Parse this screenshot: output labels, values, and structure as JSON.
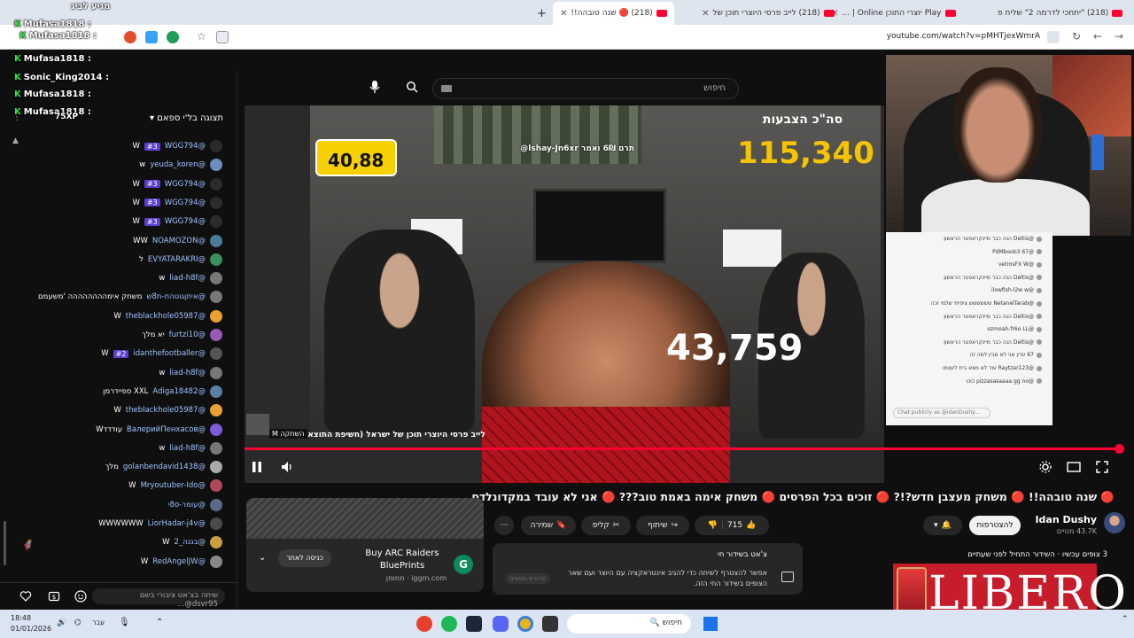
{
  "browser": {
    "tabs": [
      {
        "label": "(218) \"יתחכי לדרמה 2\" שליח פ"
      },
      {
        "label": "Play יוצרי התוכן Online | ..."
      },
      {
        "label": "(218) לייב פרסי היוצרי תוכן של"
      },
      {
        "label": "(218) 🔴 שנה טובהה!!"
      }
    ],
    "new_tab": "+",
    "url": "youtube.com/watch?v=pMHTjexWmrA"
  },
  "overlay": {
    "names": [
      "מגיע לביג",
      "Mufasa1818 :",
      "Mufasa1818 :",
      "Mufasa1818 :",
      "Sonic_King2014 :",
      "Mufasa1818 :",
      "Mufasa1818 :"
    ],
    "xp": "75XP"
  },
  "header": {
    "search_placeholder": "חיפוש"
  },
  "chat": {
    "selector": "תצוגה בל'י ספאם",
    "messages": [
      {
        "author": "@WGG794",
        "badge": "#3",
        "text": "W"
      },
      {
        "author": "@yeuda_koren",
        "badge": "",
        "text": "w"
      },
      {
        "author": "@WGG794",
        "badge": "#3",
        "text": "W"
      },
      {
        "author": "@WGG794",
        "badge": "#3",
        "text": "W"
      },
      {
        "author": "@WGG794",
        "badge": "#3",
        "text": "W"
      },
      {
        "author": "@NOAMOZON",
        "badge": "",
        "text": "WW"
      },
      {
        "author": "@EVYATARAKRI",
        "badge": "",
        "text": "ל"
      },
      {
        "author": "@liad-h8f",
        "badge": "",
        "text": "w"
      },
      {
        "author": "@איתןגוטהח-ת8ש",
        "badge": "",
        "text": "משחק אימהההההההה 'משעמם"
      },
      {
        "author": "@theblackhole05987",
        "badge": "",
        "text": "W"
      },
      {
        "author": "@furtzi10",
        "badge": "",
        "text": "יא מלך"
      },
      {
        "author": "@idanthefootballer",
        "badge": "#2",
        "text": "W"
      },
      {
        "author": "@liad-h8f",
        "badge": "",
        "text": "w"
      },
      {
        "author": "@Adiga18482",
        "badge": "",
        "text": "XXL ספיידרמן"
      },
      {
        "author": "@theblackhole05987",
        "badge": "",
        "text": "W"
      },
      {
        "author": "@ВалерийПенхасов",
        "badge": "",
        "text": "עודדדW"
      },
      {
        "author": "@liad-h8f",
        "badge": "",
        "text": "w"
      },
      {
        "author": "@golanbendavid1438",
        "badge": "",
        "text": "מלך"
      },
      {
        "author": "@Mryoutuber-Ido",
        "badge": "",
        "text": "W"
      },
      {
        "author": "@עומר-8oי",
        "badge": "",
        "text": ""
      },
      {
        "author": "@LiorHadar-j4v",
        "badge": "",
        "text": "WWWWWW"
      },
      {
        "author": "@בננה_2",
        "badge": "",
        "text": "W"
      },
      {
        "author": "@RedAngelJW",
        "badge": "",
        "text": "W"
      }
    ],
    "input_placeholder": "שיחה בצ'אט ציבורי בשם dsvr95@..."
  },
  "video": {
    "donation_amount": "40,88",
    "donation_banner": "תרם 6₪ ואמר lshay-Jn6xr@",
    "total_label": "סה\"כ הצבעות",
    "total_value": "115,340",
    "caption": "לייב פרסי היוצרי תוכן של ישראל (חשיפת התוצאות)",
    "mute_label": "השתקה",
    "bottom_total": "43,759"
  },
  "embedded_chat": {
    "lines": [
      "@Deltis הנה כבר מיינקראפטר הראשון",
      "@PdMboob3 67",
      "@vetrosFX W",
      "@Deltis הנה כבר מיינקראפטר הראשון",
      "@ilowfish-l2w w",
      "@NetanelTarab שששששש ציפיתי שלמי זכה",
      "@Deltis הנה כבר מיינקראפטר הראשון",
      "@ozmoah-fr6o LL",
      "@Deltis הנה כבר מיינקראפטר הראשון",
      "67 עדין אני לא מבין למה זה",
      "@Raytzar123 עוד לא מצא בית לעצמו",
      "@pizzasasaaaa gg no כוכו"
    ],
    "input_placeholder": "Chat publicly as @idanDushy..."
  },
  "below": {
    "title": "🔴 שנה טובהה!! 🔴 משחק מעצבן חדש?!? 🔴 זוכים בכל הפרסים 🔴 משחק אימה באמת טוב??? 🔴 אני לא עובד במקדונלדס",
    "channel_name": "Idan Dushy",
    "subscribers": "43.7K מנויים",
    "subscribe_label": "להצטרפות",
    "likes": "715",
    "share_label": "שיתוף",
    "clip_label": "קליפ",
    "save_label": "שמירה",
    "ad": {
      "title": "Buy ARC Raiders BluePrints",
      "domain": "iggm.com · ממומן",
      "logo": "G",
      "button": "כניסה לאתר"
    },
    "live_chat": {
      "title": "צ'אט בשידור חי",
      "desc": "אפשר להצטרף לשיחה כדי להגיב אינטראקציה עם היוצר ועם שאר הצופים בשידור החי הזה.",
      "more": "פרטים נוספים"
    },
    "viewers": "3 צופים עכשיו · השידור התחיל לפני שעתיים",
    "brand": "LIBERO"
  },
  "taskbar": {
    "time": "18:48",
    "date": "01/01/2026",
    "lang": "עבר",
    "search": "חיפוש"
  }
}
